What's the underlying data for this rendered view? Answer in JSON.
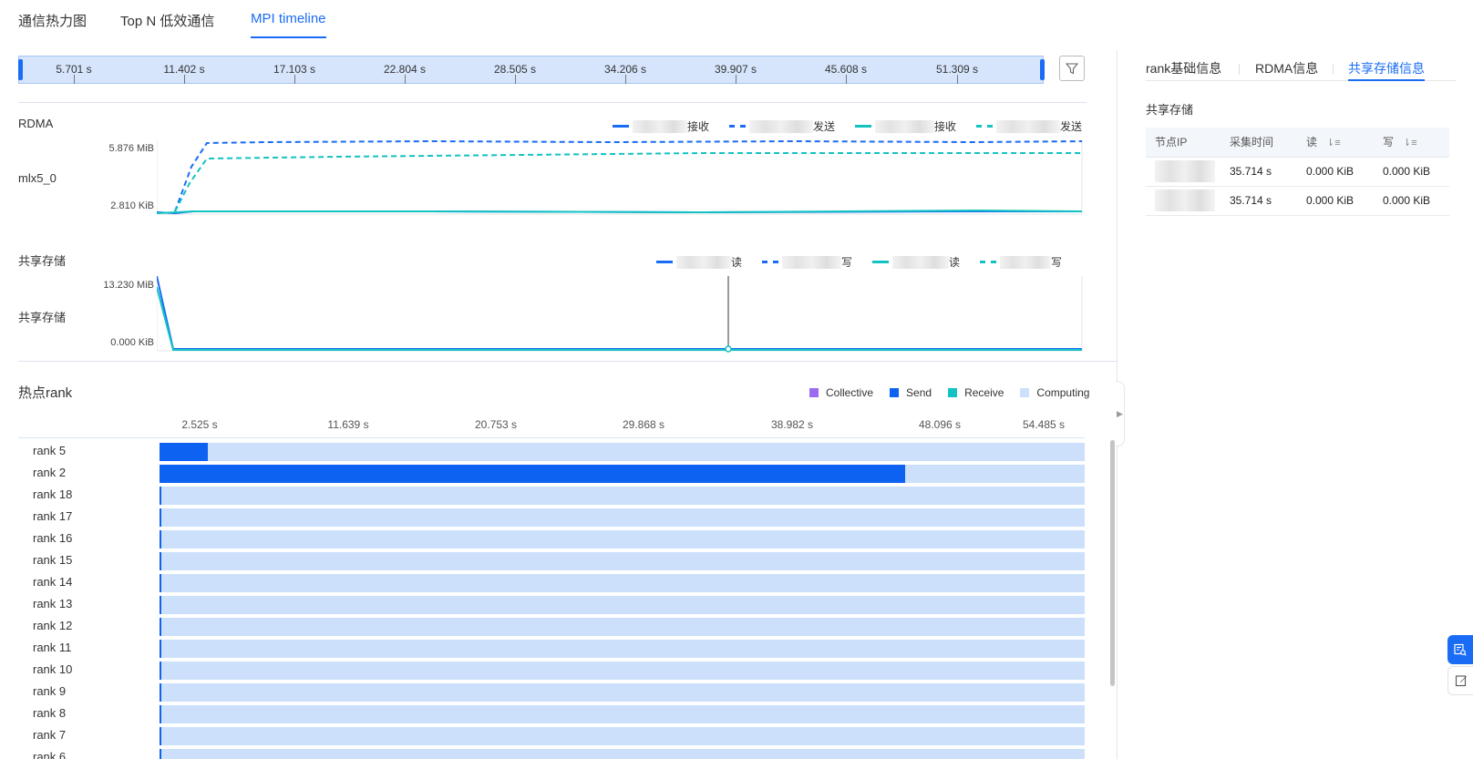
{
  "tabs": [
    "通信热力图",
    "Top N 低效通信",
    "MPI timeline"
  ],
  "time_range": {
    "ticks": [
      "5.701 s",
      "11.402 s",
      "17.103 s",
      "22.804 s",
      "28.505 s",
      "34.206 s",
      "39.907 s",
      "45.608 s",
      "51.309 s"
    ]
  },
  "filter_icon": "filter-icon",
  "rdma_section": {
    "title": "RDMA",
    "device": "mlx5_0",
    "y_max": "5.876 MiB",
    "y_min": "2.810 KiB",
    "legend": [
      "接收",
      "发送",
      "接收",
      "发送"
    ]
  },
  "storage_section": {
    "title": "共享存储",
    "row_label": "共享存储",
    "y_max": "13.230 MiB",
    "y_min": "0.000 KiB",
    "legend": [
      "读",
      "写",
      "读",
      "写"
    ]
  },
  "colors": {
    "accent": "#1a6cf5",
    "send": "#0e62f2",
    "computing": "#cce0fb",
    "receive": "#13c2c2",
    "collective": "#9b6cf0"
  },
  "right_panel": {
    "tabs": [
      "rank基础信息",
      "RDMA信息",
      "共享存储信息"
    ],
    "section_title": "共享存储",
    "columns": [
      "节点IP",
      "采集时间",
      "读",
      "写"
    ],
    "rows": [
      {
        "time": "35.714 s",
        "read": "0.000 KiB",
        "write": "0.000 KiB"
      },
      {
        "time": "35.714 s",
        "read": "0.000 KiB",
        "write": "0.000 KiB"
      }
    ]
  },
  "hot_rank": {
    "title": "热点rank",
    "legend": [
      "Collective",
      "Send",
      "Receive",
      "Computing"
    ],
    "axis_ticks": [
      "2.525 s",
      "11.639 s",
      "20.753 s",
      "29.868 s",
      "38.982 s",
      "48.096 s",
      "54.485 s"
    ],
    "ranks": [
      {
        "label": "rank 5",
        "send_fraction": 0.052
      },
      {
        "label": "rank 2",
        "send_fraction": 0.806
      },
      {
        "label": "rank 18",
        "send_fraction": 0.002
      },
      {
        "label": "rank 17",
        "send_fraction": 0.002
      },
      {
        "label": "rank 16",
        "send_fraction": 0.002
      },
      {
        "label": "rank 15",
        "send_fraction": 0.002
      },
      {
        "label": "rank 14",
        "send_fraction": 0.002
      },
      {
        "label": "rank 13",
        "send_fraction": 0.002
      },
      {
        "label": "rank 12",
        "send_fraction": 0.002
      },
      {
        "label": "rank 11",
        "send_fraction": 0.002
      },
      {
        "label": "rank 10",
        "send_fraction": 0.002
      },
      {
        "label": "rank 9",
        "send_fraction": 0.002
      },
      {
        "label": "rank 8",
        "send_fraction": 0.002
      },
      {
        "label": "rank 7",
        "send_fraction": 0.002
      },
      {
        "label": "rank 6",
        "send_fraction": 0.002
      }
    ]
  }
}
